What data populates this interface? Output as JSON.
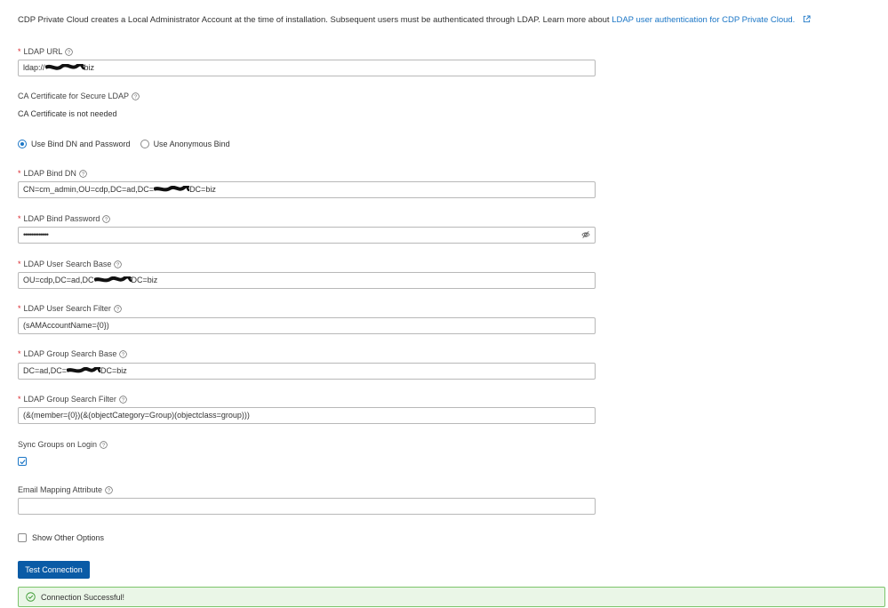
{
  "intro": {
    "text": "CDP Private Cloud creates a Local Administrator Account at the time of installation. Subsequent users must be authenticated through LDAP. Learn more about",
    "link": "LDAP user authentication for CDP Private Cloud."
  },
  "fields": {
    "ldap_url": {
      "label": "LDAP URL",
      "value_prefix": "ldap://",
      "value_suffix": "biz"
    },
    "ca_cert": {
      "label": "CA Certificate for Secure LDAP",
      "value": "CA Certificate is not needed"
    },
    "bind_mode": {
      "options": [
        "Use Bind DN and Password",
        "Use Anonymous Bind"
      ],
      "selected": "Use Bind DN and Password"
    },
    "bind_dn": {
      "label": "LDAP Bind DN",
      "value_prefix": "CN=cm_admin,OU=cdp,DC=ad,DC=",
      "value_suffix": "DC=biz"
    },
    "bind_password": {
      "label": "LDAP Bind Password",
      "value": "•••••••••••••"
    },
    "user_search_base": {
      "label": "LDAP User Search Base",
      "value_prefix": "OU=cdp,DC=ad,DC",
      "value_suffix": "DC=biz"
    },
    "user_search_filter": {
      "label": "LDAP User Search Filter",
      "value": "(sAMAccountName={0})"
    },
    "group_search_base": {
      "label": "LDAP Group Search Base",
      "value_prefix": "DC=ad,DC=",
      "value_suffix": "DC=biz"
    },
    "group_search_filter": {
      "label": "LDAP Group Search Filter",
      "value": "(&(member={0})(&(objectCategory=Group)(objectclass=group)))"
    },
    "sync_groups": {
      "label": "Sync Groups on Login",
      "checked": true
    },
    "email_mapping": {
      "label": "Email Mapping Attribute",
      "value": ""
    },
    "show_other": {
      "label": "Show Other Options",
      "checked": false
    }
  },
  "actions": {
    "test_connection": "Test Connection"
  },
  "alert": {
    "message": "Connection Successful!"
  },
  "colors": {
    "link": "#1b76c6",
    "primary": "#0a5ba6",
    "required": "#d9272e",
    "success_bg": "#eaf6e7",
    "success_border": "#7cc46a",
    "success_icon": "#3f9c35"
  }
}
